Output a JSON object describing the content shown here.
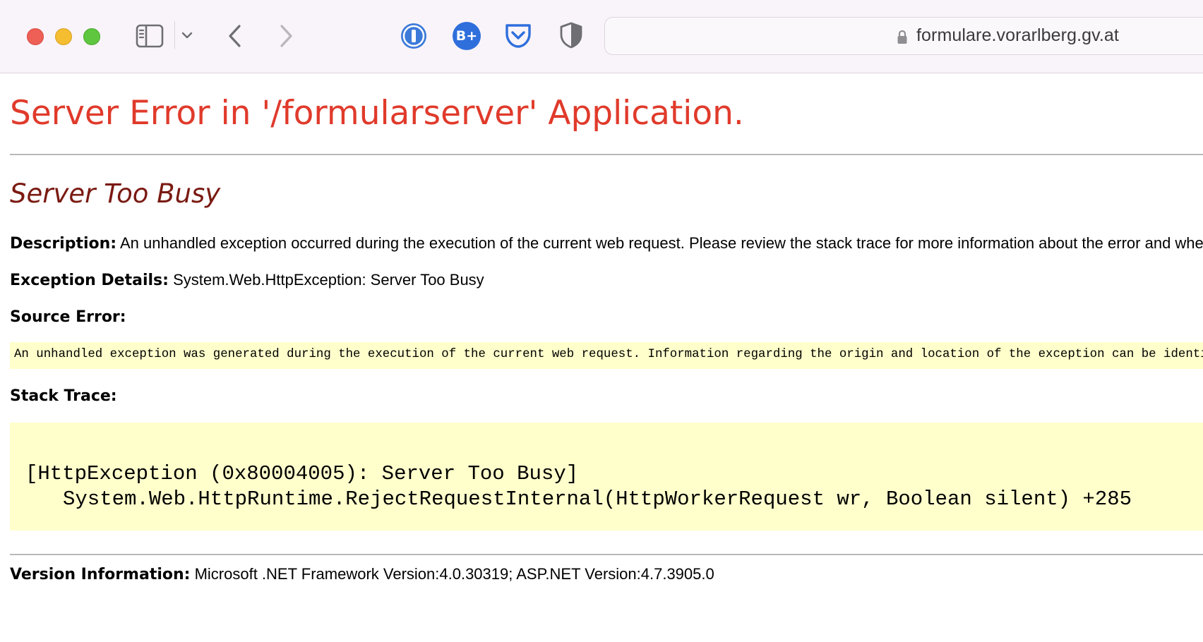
{
  "browser": {
    "url": "formulare.vorarlberg.gv.at",
    "icons": {
      "sidebar": "sidebar-icon",
      "chevron": "chevron-down-icon",
      "back": "back-arrow-icon",
      "forward": "forward-arrow-icon",
      "ext1": "1password-icon",
      "ext2": "bplus-icon",
      "ext3": "pocket-icon",
      "ext4": "shield-icon",
      "lock": "lock-icon"
    },
    "ext2_label": "B+"
  },
  "page": {
    "title": "Server Error in '/formularserver' Application.",
    "error_heading": "Server Too Busy",
    "description_label": "Description:",
    "description_text": "An unhandled exception occurred during the execution of the current web request. Please review the stack trace for more information about the error and where it originated in the code.",
    "exception_label": "Exception Details:",
    "exception_text": "System.Web.HttpException: Server Too Busy",
    "source_error_label": "Source Error:",
    "source_error_text": "An unhandled exception was generated during the execution of the current web request. Information regarding the origin and location of the exception can be identified using the exception stack trace below.",
    "stack_trace_label": "Stack Trace:",
    "stack_line_1": "[HttpException (0x80004005): Server Too Busy]",
    "stack_line_2": "System.Web.HttpRuntime.RejectRequestInternal(HttpWorkerRequest wr, Boolean silent) +285",
    "version_label": "Version Information:",
    "version_text": "Microsoft .NET Framework Version:4.0.30319; ASP.NET Version:4.7.3905.0"
  },
  "colors": {
    "title_red": "#e03a2b",
    "heading_maroon": "#7a1a12",
    "code_background": "#ffffcc",
    "toolbar_background": "#f9f4f9"
  }
}
